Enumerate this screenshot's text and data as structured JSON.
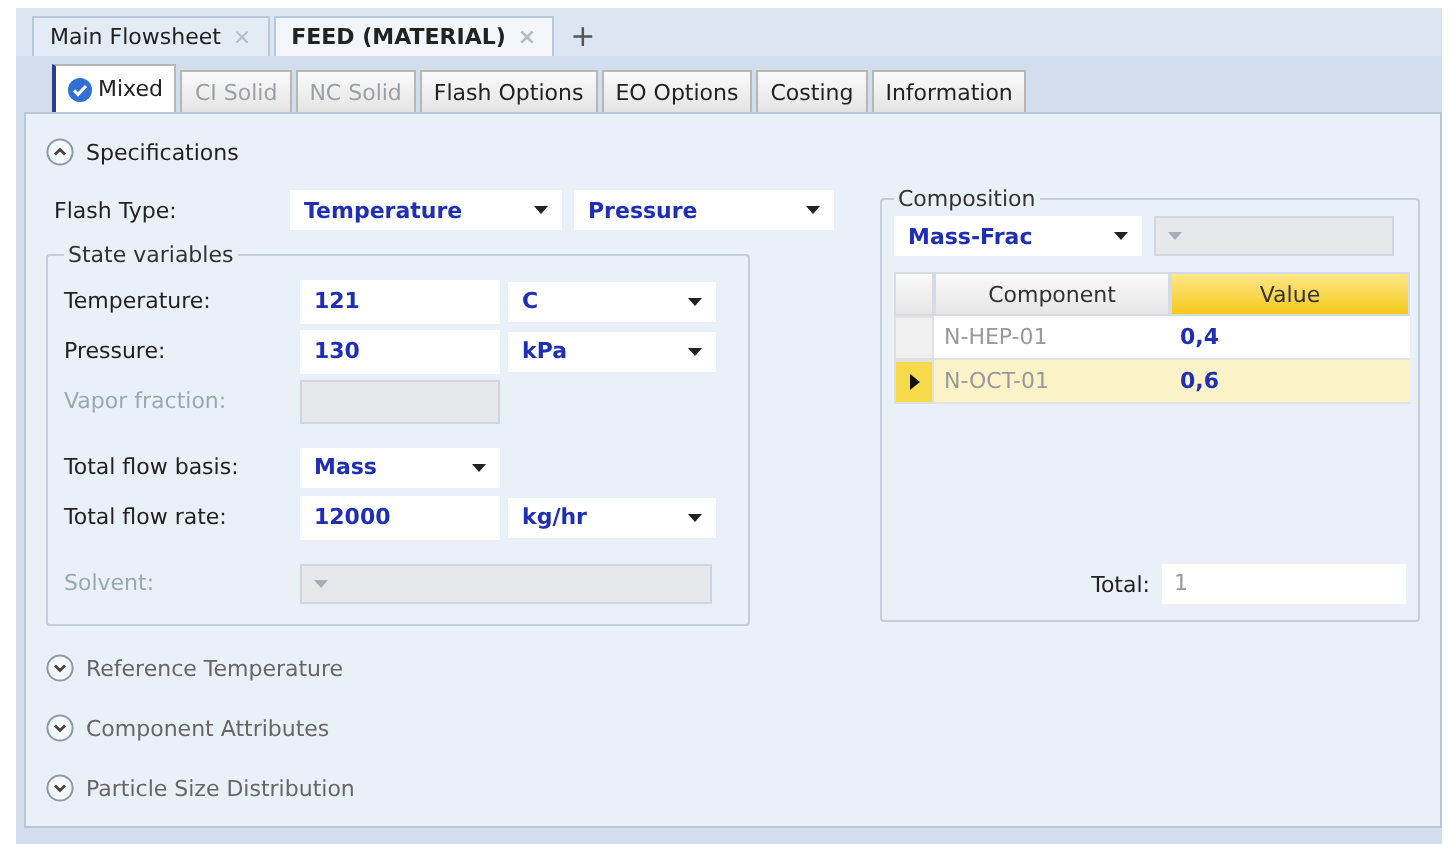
{
  "document_tabs": [
    {
      "label": "Main Flowsheet",
      "selected": false,
      "close": "×"
    },
    {
      "label": "FEED (MATERIAL)",
      "selected": true,
      "close": "×"
    }
  ],
  "new_tab": "+",
  "property_tabs": [
    {
      "label": "Mixed",
      "selected": true,
      "disabled": false,
      "complete": true
    },
    {
      "label": "CI Solid",
      "selected": false,
      "disabled": true,
      "complete": false
    },
    {
      "label": "NC Solid",
      "selected": false,
      "disabled": true,
      "complete": false
    },
    {
      "label": "Flash Options",
      "selected": false,
      "disabled": false,
      "complete": false
    },
    {
      "label": "EO Options",
      "selected": false,
      "disabled": false,
      "complete": false
    },
    {
      "label": "Costing",
      "selected": false,
      "disabled": false,
      "complete": false
    },
    {
      "label": "Information",
      "selected": false,
      "disabled": false,
      "complete": false
    }
  ],
  "specifications": {
    "title": "Specifications",
    "expanded": true,
    "flash_type": {
      "label": "Flash Type:",
      "values": [
        "Temperature",
        "Pressure"
      ]
    },
    "state_variables": {
      "title": "State variables",
      "rows": [
        {
          "label": "Temperature:",
          "value": "121",
          "unit": "C",
          "disabled": false
        },
        {
          "label": "Pressure:",
          "value": "130",
          "unit": "kPa",
          "disabled": false
        },
        {
          "label": "Vapor fraction:",
          "disabled": true
        },
        {
          "kind": "select",
          "label": "Total flow basis:",
          "select": "Mass",
          "disabled": false,
          "gap": true
        },
        {
          "label": "Total flow rate:",
          "value": "12000",
          "unit": "kg/hr",
          "disabled": false
        },
        {
          "kind": "wide_select",
          "label": "Solvent:",
          "disabled": true,
          "gap": true
        }
      ]
    }
  },
  "composition": {
    "title": "Composition",
    "basis": "Mass-Frac",
    "columns": [
      "Component",
      "Value"
    ],
    "rows": [
      {
        "component": "N-HEP-01",
        "value": "0,4",
        "selected": false
      },
      {
        "component": "N-OCT-01",
        "value": "0,6",
        "selected": true
      }
    ],
    "total_label": "Total:",
    "total": "1"
  },
  "sections": [
    {
      "title": "Reference Temperature",
      "expanded": false
    },
    {
      "title": "Component Attributes",
      "expanded": false
    },
    {
      "title": "Particle Size Distribution",
      "expanded": false
    }
  ]
}
